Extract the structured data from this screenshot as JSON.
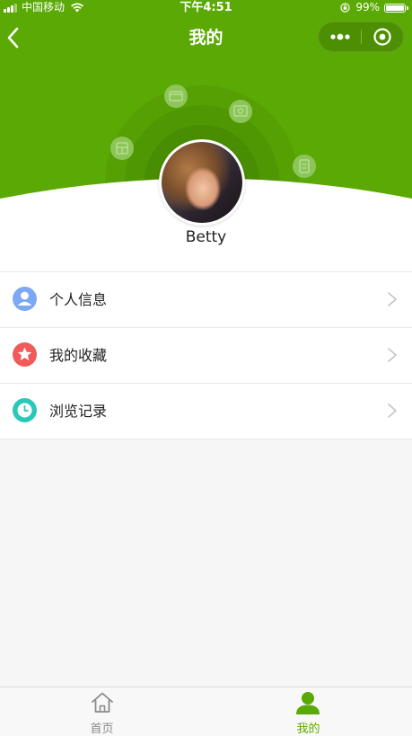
{
  "status_bar": {
    "carrier": "中国移动",
    "time": "下午4:51",
    "battery_percent": "99%",
    "battery_level": 0.99,
    "icons": [
      "signal-icon",
      "wifi-icon",
      "rotation-lock-icon",
      "battery-icon"
    ]
  },
  "nav": {
    "title": "我的",
    "back_icon": "chevron-left-icon",
    "more_icon": "more-dots-icon",
    "close_icon": "target-circle-icon"
  },
  "profile": {
    "username": "Betty",
    "avatar_icon": "avatar"
  },
  "menu": {
    "items": [
      {
        "label": "个人信息",
        "icon": "person-icon",
        "icon_color": "#7ba9f5"
      },
      {
        "label": "我的收藏",
        "icon": "star-icon",
        "icon_color": "#f15a5a"
      },
      {
        "label": "浏览记录",
        "icon": "clock-icon",
        "icon_color": "#29c8b8"
      }
    ]
  },
  "tab_bar": {
    "tabs": [
      {
        "label": "首页",
        "icon": "home-icon",
        "active": false
      },
      {
        "label": "我的",
        "icon": "person-icon",
        "active": true
      }
    ]
  },
  "colors": {
    "brand_green": "#5ba904",
    "background": "#f6f6f6",
    "inactive_tab": "#888888"
  }
}
